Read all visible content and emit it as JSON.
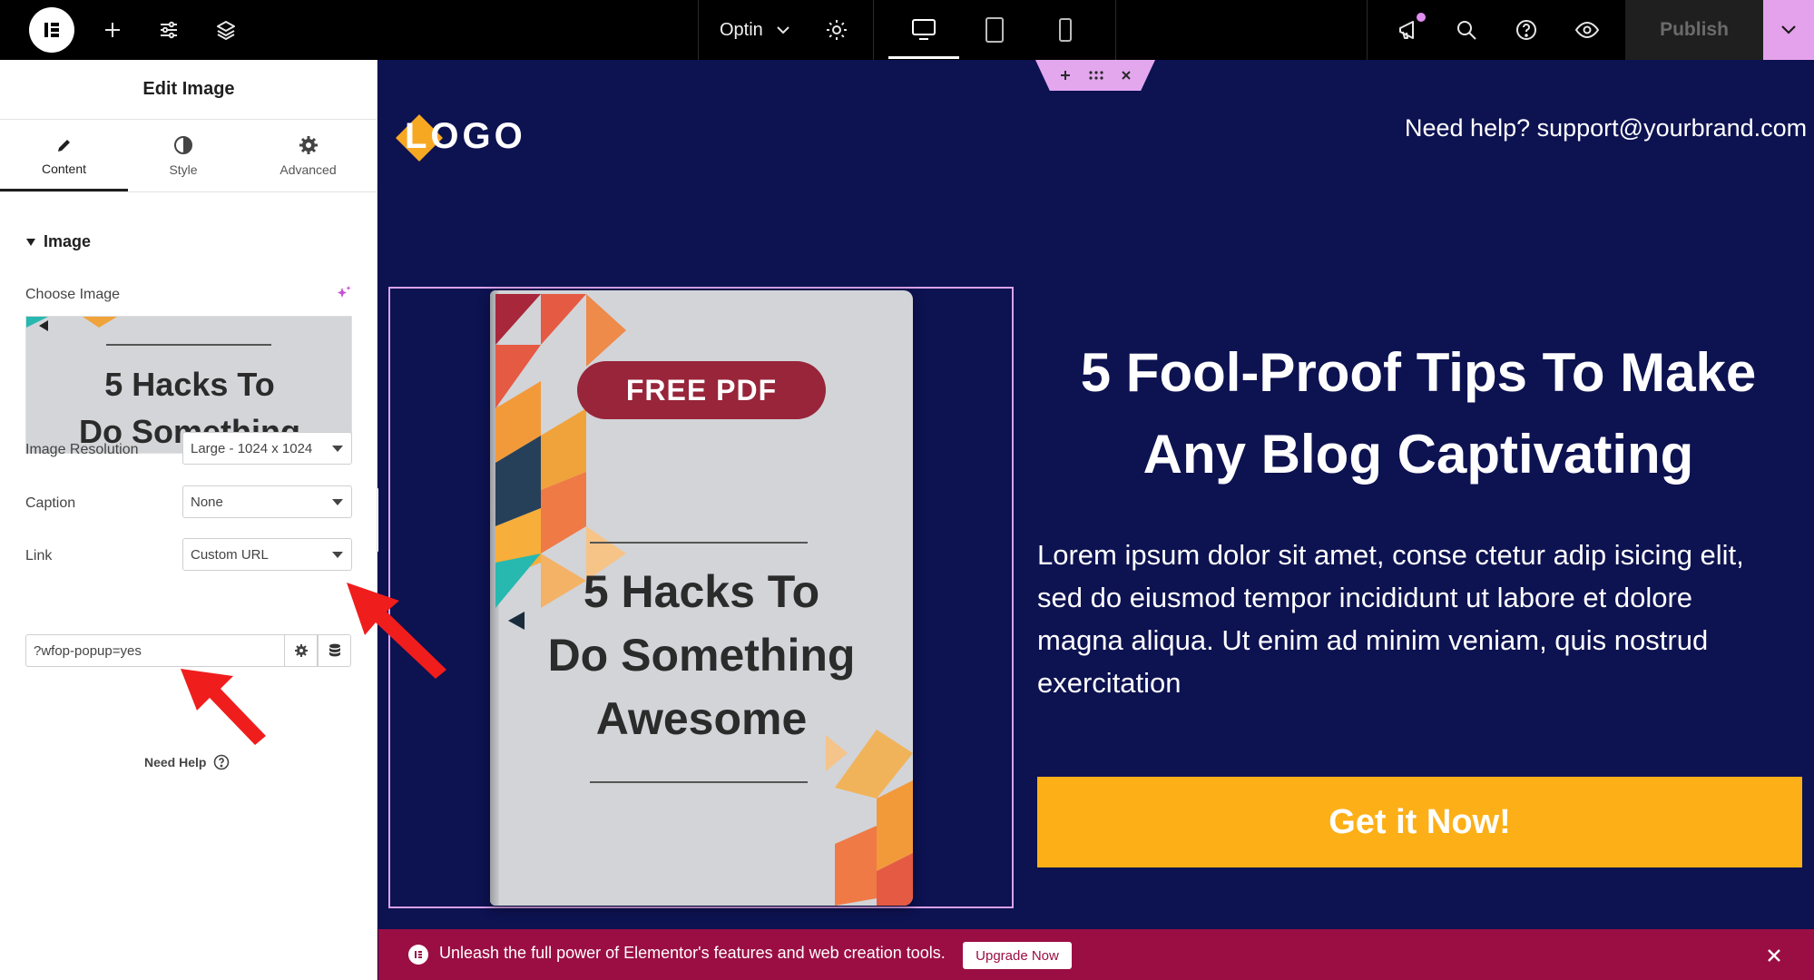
{
  "topbar": {
    "template_name": "Optin",
    "publish_label": "Publish"
  },
  "panel": {
    "title": "Edit Image",
    "tabs": [
      {
        "label": "Content",
        "icon": "pencil-icon"
      },
      {
        "label": "Style",
        "icon": "half-circle-icon"
      },
      {
        "label": "Advanced",
        "icon": "gear-icon"
      }
    ],
    "section_title": "Image",
    "choose_image_label": "Choose Image",
    "preview_text_line1": "5 Hacks To",
    "preview_text_line2": "Do Something",
    "resolution_label": "Image Resolution",
    "resolution_value": "Large - 1024 x 1024",
    "caption_label": "Caption",
    "caption_value": "None",
    "link_label": "Link",
    "link_value": "Custom URL",
    "url_value": "?wfop-popup=yes",
    "need_help": "Need Help"
  },
  "canvas": {
    "logo_text": "LOGO",
    "help_text": "Need help? support@yourbrand.com",
    "book_badge": "FREE PDF",
    "book_title_1": "5 Hacks To",
    "book_title_2": "Do Something",
    "book_title_3": "Awesome",
    "headline_1": "5 Fool-Proof Tips To Make",
    "headline_2": "Any Blog Captivating",
    "body": "Lorem ipsum dolor sit amet, conse ctetur adip isicing elit, sed do eiusmod tempor incididunt ut labore et dolore magna aliqua. Ut enim ad minim veniam, quis nostrud exercitation",
    "cta_label": "Get it Now!"
  },
  "banner": {
    "text": "Unleash the full power of Elementor's features and web creation tools.",
    "upgrade_label": "Upgrade Now"
  },
  "colors": {
    "canvas_bg": "#0d1251",
    "cta": "#fcaf17",
    "banner": "#9b0e43",
    "accent_pink": "#e5a2ec",
    "badge": "#98253a",
    "annotation_arrow": "#f01d1d"
  }
}
